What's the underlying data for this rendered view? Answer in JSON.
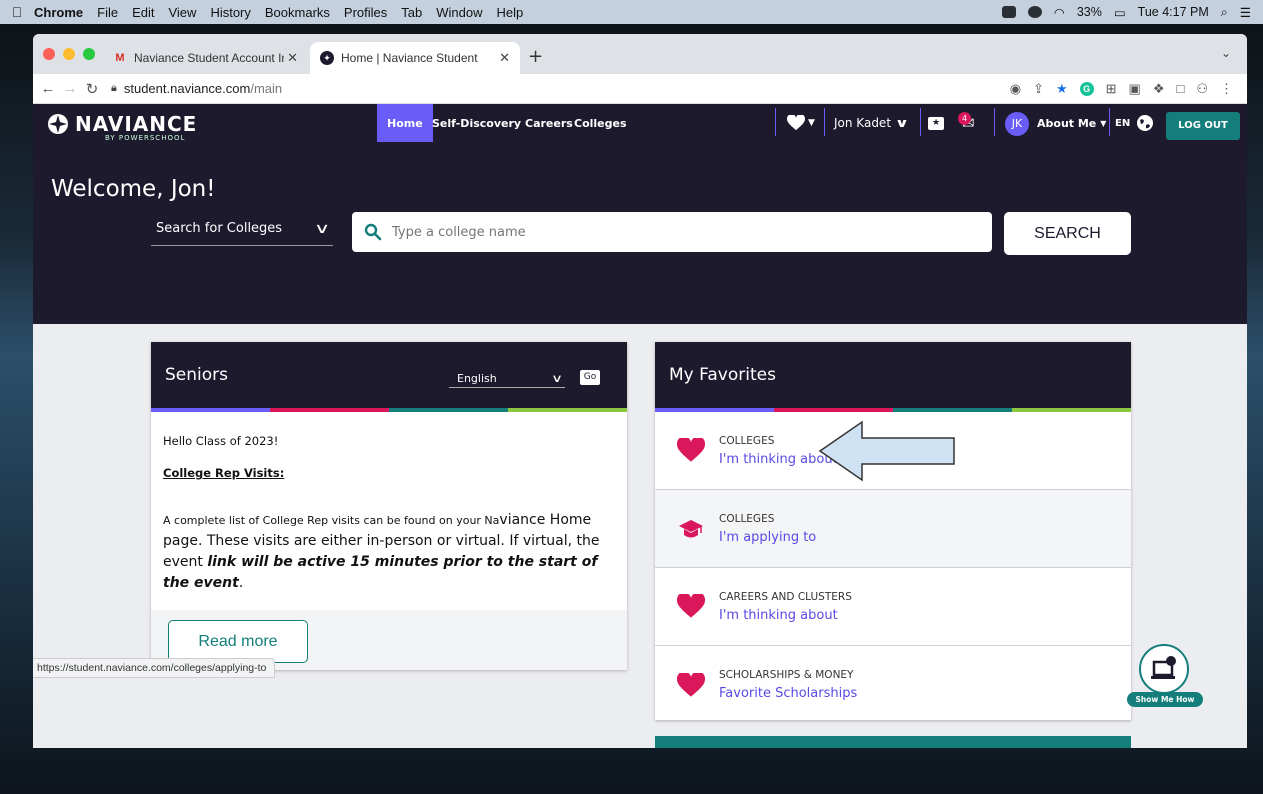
{
  "menubar": {
    "apple": "",
    "items": [
      "Chrome",
      "File",
      "Edit",
      "View",
      "History",
      "Bookmarks",
      "Profiles",
      "Tab",
      "Window",
      "Help"
    ],
    "battery": "33%",
    "clock": "Tue 4:17 PM"
  },
  "browser": {
    "tabs": [
      {
        "title": "Naviance Student Account Info",
        "favicon": "gmail-icon"
      },
      {
        "title": "Home | Naviance Student",
        "favicon": "naviance-icon",
        "active": true
      }
    ],
    "new_tab": "+",
    "url_host": "student.naviance.com",
    "url_path": "/main",
    "status_link": "https://student.naviance.com/colleges/applying-to"
  },
  "nav": {
    "logo": "NAVIANCE",
    "logo_sub": "BY POWERSCHOOL",
    "tabs": [
      "Home",
      "Self-Discovery",
      "Careers",
      "Colleges"
    ],
    "active_tab": "Home",
    "user_name": "Jon Kadet",
    "message_count": "4",
    "avatar_initials": "JK",
    "about_me": "About Me",
    "language": "EN",
    "logout": "LOG OUT"
  },
  "hero": {
    "welcome": "Welcome, Jon!",
    "search_for": "Search for Colleges",
    "search_placeholder": "Type a college name",
    "search_button": "SEARCH"
  },
  "seniors": {
    "title": "Seniors",
    "language": "English",
    "go": "Go",
    "hello": "Hello Class of 2023!",
    "heading": "College Rep Visits:",
    "p_a": "A complete list of College Rep visits can be found on your Na",
    "p_b": "viance Home",
    "p_c": " page. These visits are either in-person or virtual. If virtual, the event ",
    "p_d": "link will be active 15 minutes prior to the start of the event",
    "p_e": ".",
    "read_more": "Read more"
  },
  "favorites": {
    "title": "My Favorites",
    "items": [
      {
        "category": "COLLEGES",
        "link": "I'm thinking about",
        "icon": "heart-icon"
      },
      {
        "category": "COLLEGES",
        "link": "I'm applying to",
        "icon": "graduation-cap-icon"
      },
      {
        "category": "CAREERS AND CLUSTERS",
        "link": "I'm thinking about",
        "icon": "heart-icon"
      },
      {
        "category": "SCHOLARSHIPS & MONEY",
        "link": "Favorite Scholarships",
        "icon": "heart-icon"
      }
    ]
  },
  "show_me_how": "Show Me How",
  "colors": {
    "navy": "#1e1a2e",
    "purple": "#6a5cf6",
    "teal": "#137e7a",
    "magenta": "#d9175a",
    "link": "#5b49e6",
    "stripes": [
      "#6a5cf6",
      "#d9175a",
      "#137e7a",
      "#8cc63f"
    ]
  }
}
